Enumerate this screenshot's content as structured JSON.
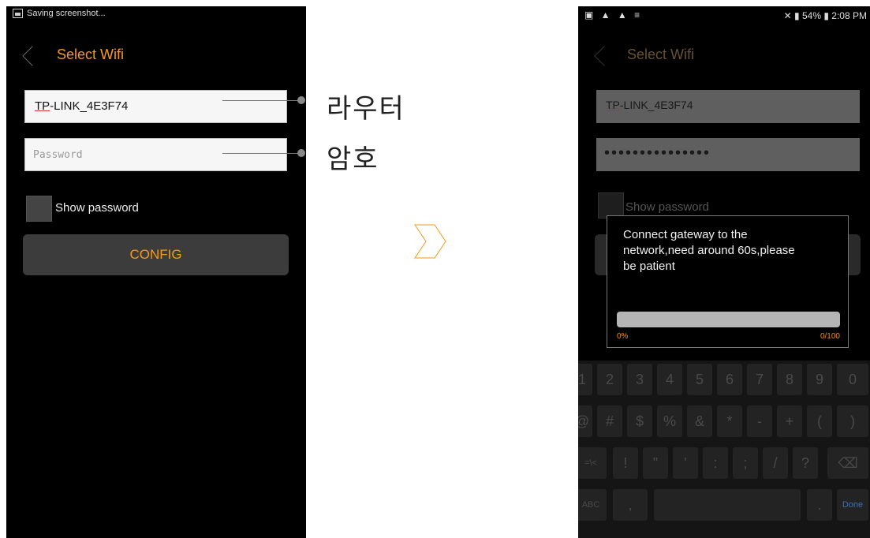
{
  "left_screen": {
    "status_text": "Saving screenshot...",
    "title": "Select Wifi",
    "ssid_value_prefix": "TP",
    "ssid_value_rest": "-LINK_4E3F74",
    "password_placeholder": "Password",
    "show_password_label": "Show password",
    "config_button": "CONFIG"
  },
  "callouts": {
    "router": "라우터",
    "password": "암호"
  },
  "right_screen": {
    "status_time": "2:08 PM",
    "status_battery": "54%",
    "title": "Select Wifi",
    "ssid_value_prefix": "TP",
    "ssid_value_rest": "-LINK_4E3F74",
    "password_mask": "•••••••••••••••",
    "show_password_label": "Show password",
    "dialog_message": "Connect gateway to the network,need around 60s,please be patient",
    "progress_percent_label": "0%",
    "progress_count_label": "0/100",
    "progress_value": 0,
    "keyboard": {
      "row1": [
        "1",
        "2",
        "3",
        "4",
        "5",
        "6",
        "7",
        "8",
        "9",
        "0"
      ],
      "row2": [
        "@",
        "#",
        "$",
        "%",
        "&",
        "*",
        "-",
        "+",
        "(",
        ")"
      ],
      "row3": [
        "=\\<",
        "!",
        "\"",
        "'",
        ":",
        ";",
        "/",
        "?",
        "⌫"
      ],
      "row4_abc": "ABC",
      "row4_comma": ",",
      "row4_period": ".",
      "row4_done": "Done"
    }
  },
  "colors": {
    "accent": "#f39a1e",
    "background": "#000000"
  }
}
